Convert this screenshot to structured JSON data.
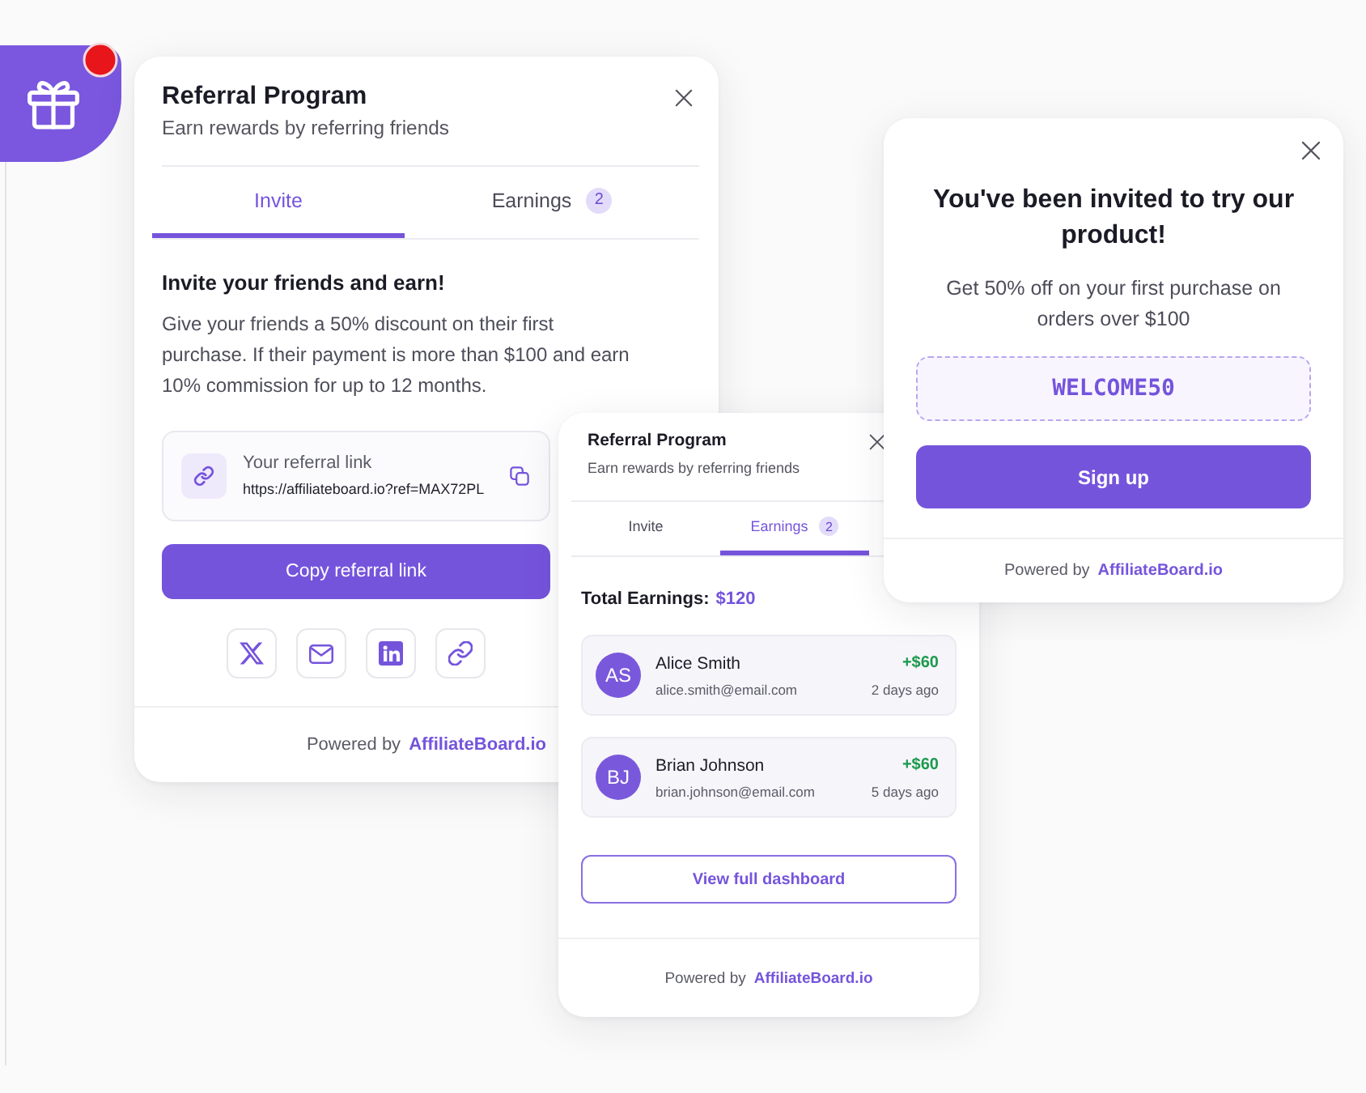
{
  "launcher": {
    "notification": true
  },
  "invite_widget": {
    "title": "Referral Program",
    "subtitle": "Earn rewards by referring friends",
    "tabs": [
      {
        "label": "Invite",
        "selected": true
      },
      {
        "label": "Earnings",
        "badge": "2",
        "selected": false
      }
    ],
    "heading": "Invite your friends and earn!",
    "description": "Give your friends a 50% discount on their first purchase. If their payment is more than $100 and earn 10% commission for up to 12 months.",
    "referral_link": {
      "label": "Your referral link",
      "value": "https://affiliateboard.io?ref=MAX72PL"
    },
    "copy_button": "Copy referral link",
    "share_buttons": [
      {
        "kind": "x"
      },
      {
        "kind": "email"
      },
      {
        "kind": "linkedin"
      },
      {
        "kind": "link"
      }
    ],
    "footer": {
      "text": "Powered by",
      "brand": "AffiliateBoard.io"
    }
  },
  "earnings_widget": {
    "title": "Referral Program",
    "subtitle": "Earn rewards by referring friends",
    "tabs": [
      {
        "label": "Invite",
        "selected": false
      },
      {
        "label": "Earnings",
        "badge": "2",
        "selected": true
      }
    ],
    "total_label": "Total Earnings:",
    "total": "$120",
    "referrals": [
      {
        "initials": "AS",
        "name": "Alice Smith",
        "email": "alice.smith@email.com",
        "amount": "+$60",
        "time": "2 days ago"
      },
      {
        "initials": "BJ",
        "name": "Brian Johnson",
        "email": "brian.johnson@email.com",
        "amount": "+$60",
        "time": "5 days ago"
      }
    ],
    "dashboard_button": "View full dashboard",
    "footer": {
      "text": "Powered by",
      "brand": "AffiliateBoard.io"
    }
  },
  "invitation_popup": {
    "title": "You've been invited to try our product!",
    "description": "Get 50% off on your first purchase on orders over $100",
    "promo_code": "WELCOME50",
    "signup_button": "Sign up",
    "footer": {
      "text": "Powered by",
      "brand": "AffiliateBoard.io"
    }
  }
}
